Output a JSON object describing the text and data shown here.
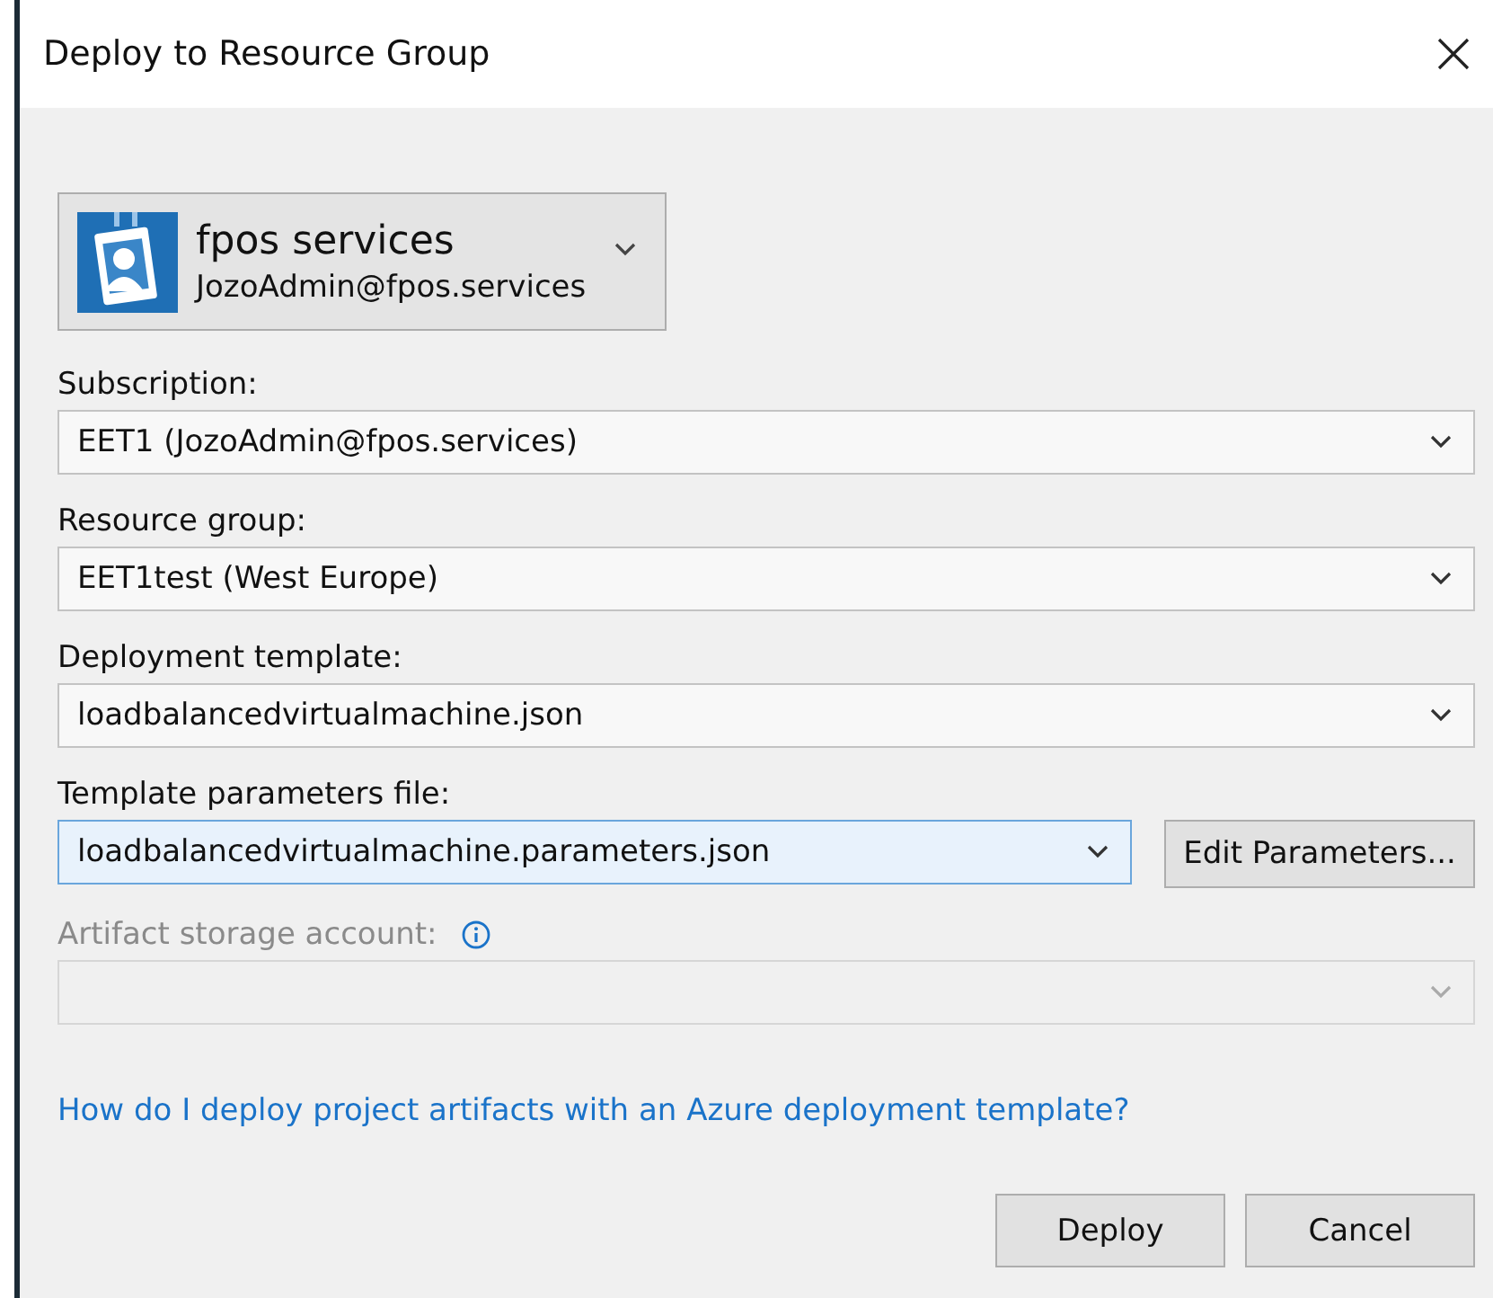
{
  "window": {
    "title": "Deploy to Resource Group"
  },
  "account": {
    "name": "fpos services",
    "email": "JozoAdmin@fpos.services"
  },
  "fields": [
    {
      "label": "Subscription:",
      "value": "EET1 (JozoAdmin@fpos.services)",
      "focused": false,
      "disabled": false
    },
    {
      "label": "Resource group:",
      "value": "EET1test (West Europe)",
      "focused": false,
      "disabled": false
    },
    {
      "label": "Deployment template:",
      "value": "loadbalancedvirtualmachine.json",
      "focused": false,
      "disabled": false
    },
    {
      "label": "Template parameters file:",
      "value": "loadbalancedvirtualmachine.parameters.json",
      "focused": true,
      "disabled": false,
      "button": "Edit Parameters..."
    },
    {
      "label": "Artifact storage account:",
      "focused": false,
      "disabled": true,
      "info": true
    }
  ],
  "help_link": "How do I deploy project artifacts with an Azure deployment template?",
  "buttons": [
    "Deploy",
    "Cancel"
  ]
}
